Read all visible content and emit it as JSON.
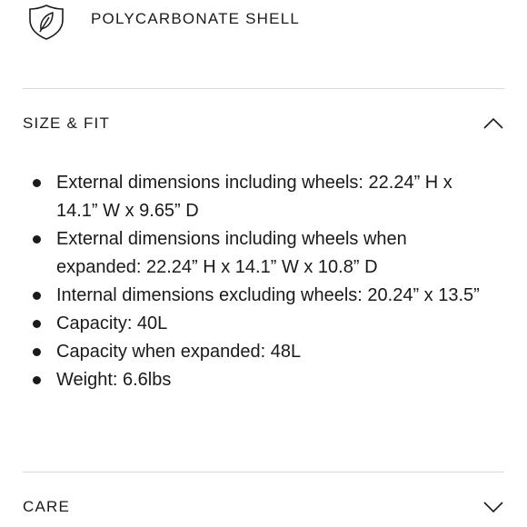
{
  "feature": {
    "icon": "shield-leaf-icon",
    "label": "POLYCARBONATE SHELL"
  },
  "size_fit": {
    "title": "SIZE & FIT",
    "toggle_icon": "chevron-up-icon",
    "expanded": true,
    "items": [
      "External dimensions including wheels: 22.24” H x 14.1” W x 9.65” D",
      "External dimensions including wheels when expanded: 22.24” H x 14.1” W x 10.8” D",
      "Internal dimensions excluding wheels: 20.24” x 13.5”",
      "Capacity: 40L",
      "Capacity when expanded: 48L",
      "Weight: 6.6lbs"
    ]
  },
  "care": {
    "title": "CARE",
    "toggle_icon": "chevron-down-icon",
    "expanded": false
  },
  "colors": {
    "text": "#1a1a1a",
    "divider": "#d9d9d9",
    "background": "#ffffff"
  }
}
